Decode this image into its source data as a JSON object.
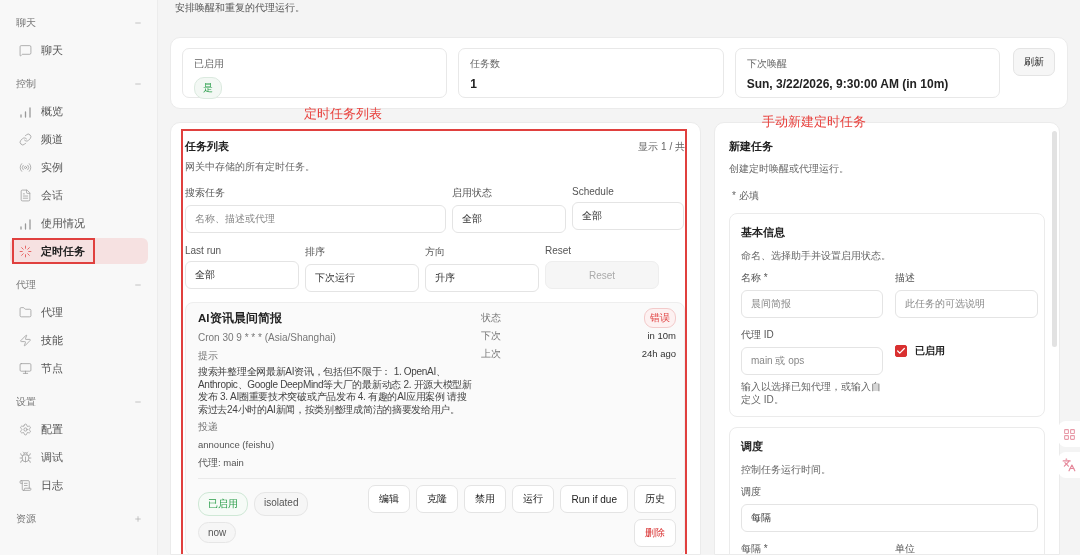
{
  "page": {
    "subtitle": "安排唤醒和重复的代理运行。"
  },
  "sidebar": {
    "sections": [
      {
        "title": "聊天",
        "expanded": true,
        "items": [
          {
            "label": "聊天",
            "selected": false,
            "highlighted": false
          }
        ]
      },
      {
        "title": "控制",
        "expanded": true,
        "items": [
          {
            "label": "概览",
            "selected": false,
            "highlighted": false
          },
          {
            "label": "频道",
            "selected": false,
            "highlighted": false
          },
          {
            "label": "实例",
            "selected": false,
            "highlighted": false
          },
          {
            "label": "会话",
            "selected": false,
            "highlighted": false
          },
          {
            "label": "使用情况",
            "selected": false,
            "highlighted": false
          },
          {
            "label": "定时任务",
            "selected": true,
            "highlighted": true
          }
        ]
      },
      {
        "title": "代理",
        "expanded": true,
        "items": [
          {
            "label": "代理",
            "selected": false,
            "highlighted": false
          },
          {
            "label": "技能",
            "selected": false,
            "highlighted": false
          },
          {
            "label": "节点",
            "selected": false,
            "highlighted": false
          }
        ]
      },
      {
        "title": "设置",
        "expanded": true,
        "items": [
          {
            "label": "配置",
            "selected": false,
            "highlighted": false
          },
          {
            "label": "调试",
            "selected": false,
            "highlighted": false
          },
          {
            "label": "日志",
            "selected": false,
            "highlighted": false
          }
        ]
      },
      {
        "title": "资源",
        "expanded": false
      }
    ]
  },
  "stats": [
    {
      "label": "已启用",
      "kind": "badge",
      "value": "是"
    },
    {
      "label": "任务数",
      "kind": "text",
      "value": "1"
    },
    {
      "label": "下次唤醒",
      "kind": "text",
      "value": "Sun, 3/22/2026, 9:30:00 AM (in 10m)"
    }
  ],
  "refresh_button": "刷新",
  "job_list": {
    "annotation": "定时任务列表",
    "highlighted": true,
    "title": "任务列表",
    "count": "显示 1 / 共",
    "subtitle": "网关中存储的所有定时任务。",
    "filters": [
      [
        {
          "label": "搜索任务",
          "kind": "search",
          "placeholder": "名称、描述或代理"
        },
        {
          "label": "启用状态",
          "kind": "select",
          "value": "全部"
        },
        {
          "label": "Schedule",
          "kind": "select",
          "value": "全部"
        }
      ],
      [
        {
          "label": "Last run",
          "kind": "select",
          "value": "全部"
        },
        {
          "label": "排序",
          "kind": "select",
          "value": "下次运行"
        },
        {
          "label": "方向",
          "kind": "select",
          "value": "升序"
        },
        {
          "label": "Reset",
          "kind": "button",
          "value": "Reset",
          "disabled": true
        }
      ]
    ],
    "jobs": [
      {
        "name": "AI资讯晨间简报",
        "schedule": "Cron 30 9 * * * (Asia/Shanghai)",
        "prompt_label": "提示",
        "prompt": "搜索并整理全网最新AI资讯，包括但不限于： 1. OpenAI、Anthropic、Google DeepMind等大厂的最新动态 2. 开源大模型新发布 3. AI圈重要技术突破或产品发布 4. 有趣的AI应用案例 请搜索过去24小时的AI新闻，按类别整理成简洁的摘要发给用户。",
        "delivery_label": "投递",
        "delivery": "announce (feishu)",
        "agent": "代理: main",
        "meta": [
          {
            "label": "状态",
            "kind": "badge",
            "value": "错误"
          },
          {
            "label": "下次",
            "kind": "text",
            "value": "in 10m"
          },
          {
            "label": "上次",
            "kind": "text",
            "value": "24h ago"
          }
        ],
        "tags": [
          {
            "text": "已启用",
            "kind": "success"
          },
          {
            "text": "isolated",
            "kind": "plain"
          },
          {
            "text": "now",
            "kind": "plain"
          }
        ],
        "actions": [
          {
            "label": "编辑",
            "danger": false
          },
          {
            "label": "克隆",
            "danger": false
          },
          {
            "label": "禁用",
            "danger": false
          },
          {
            "label": "运行",
            "danger": false
          },
          {
            "label": "Run if due",
            "danger": false
          },
          {
            "label": "历史",
            "danger": false
          },
          {
            "label": "删除",
            "danger": true
          }
        ]
      }
    ]
  },
  "create_form": {
    "annotation": "手动新建定时任务",
    "title": "新建任务",
    "subtitle": "创建定时唤醒或代理运行。",
    "required_note": "* 必填",
    "sections": [
      {
        "title": "基本信息",
        "description": "命名、选择助手并设置启用状态。",
        "fields": [
          {
            "kind": "input",
            "label": "名称 *",
            "placeholder": "晨间简报"
          },
          {
            "kind": "input",
            "label": "描述",
            "placeholder": "此任务的可选说明"
          },
          {
            "kind": "input",
            "label": "代理 ID",
            "placeholder": "main 或 ops",
            "hint": "输入以选择已知代理，或输入自定义 ID。"
          },
          {
            "kind": "checkbox",
            "label": "已启用",
            "checked": true
          }
        ]
      },
      {
        "title": "调度",
        "description": "控制任务运行时间。",
        "fields": [
          {
            "kind": "wide-select",
            "label": "调度",
            "value": "每隔"
          },
          {
            "kind": "label",
            "label": "每隔 *"
          },
          {
            "kind": "label",
            "label": "单位"
          }
        ]
      }
    ]
  }
}
